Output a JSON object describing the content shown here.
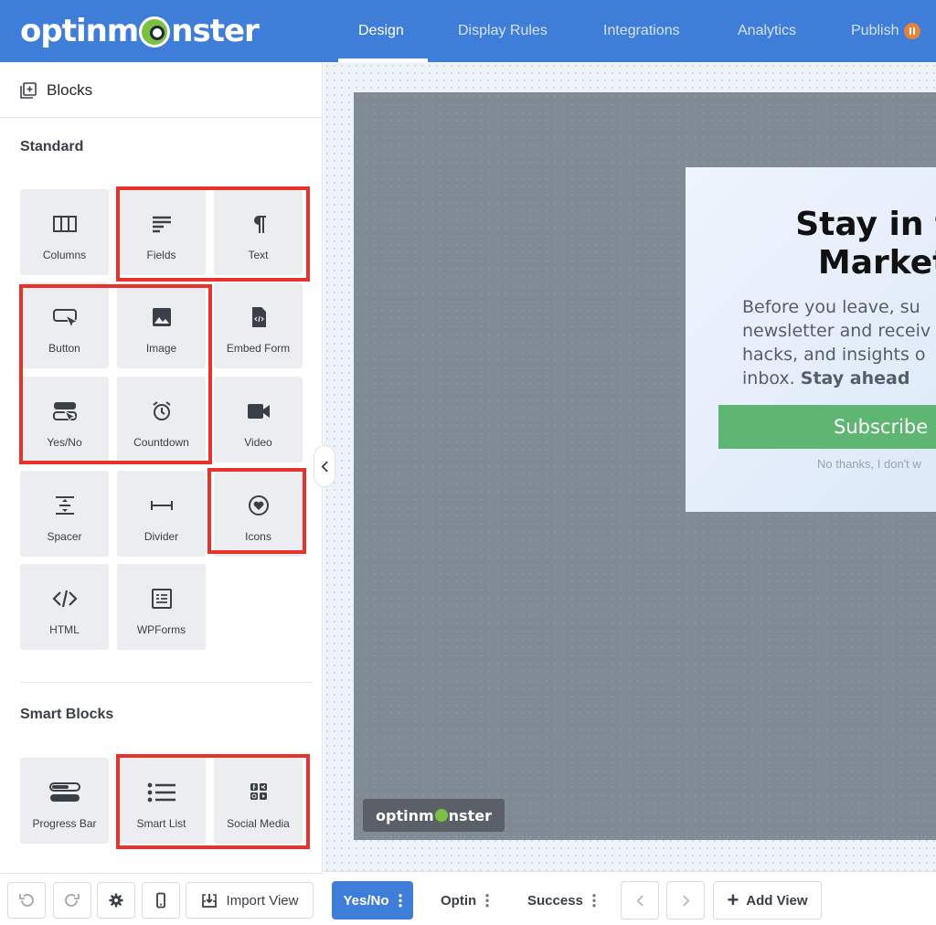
{
  "app": {
    "logo_text_start": "optinm",
    "logo_text_end": "nster"
  },
  "nav": {
    "tabs": [
      {
        "label": "Design",
        "active": true
      },
      {
        "label": "Display Rules",
        "active": false
      },
      {
        "label": "Integrations",
        "active": false
      },
      {
        "label": "Analytics",
        "active": false
      },
      {
        "label": "Publish",
        "active": false
      }
    ]
  },
  "sidebar": {
    "header": "Blocks",
    "standard_title": "Standard",
    "standard_blocks": [
      "Columns",
      "Fields",
      "Text",
      "Button",
      "Image",
      "Embed Form",
      "Yes/No",
      "Countdown",
      "Video",
      "Spacer",
      "Divider",
      "Icons",
      "HTML",
      "WPForms"
    ],
    "smart_title": "Smart Blocks",
    "smart_blocks": [
      "Progress Bar",
      "Smart List",
      "Social Media"
    ],
    "footer": {
      "import_label": "Import View"
    }
  },
  "popup": {
    "headline_line1": "Stay in the L",
    "headline_line2": "Marketing",
    "body_line1": "Before you leave, su",
    "body_line2": "newsletter and receiv",
    "body_line3": "hacks, and insights o",
    "body_line4_plain": "inbox.",
    "body_line4_bold": "Stay ahead",
    "subscribe_label": "Subscribe",
    "no_thanks": "No thanks, I don't w"
  },
  "canvas": {
    "brand_start": "optinm",
    "brand_end": "nster"
  },
  "bottombar": {
    "views": [
      {
        "label": "Yes/No",
        "active": true
      },
      {
        "label": "Optin",
        "active": false
      },
      {
        "label": "Success",
        "active": false
      }
    ],
    "add_view_label": "Add View"
  },
  "colors": {
    "brand_blue": "#3f7ed8",
    "highlight_red": "#e8332a",
    "subscribe_green": "#5fb572",
    "publish_badge": "#e8813b"
  }
}
